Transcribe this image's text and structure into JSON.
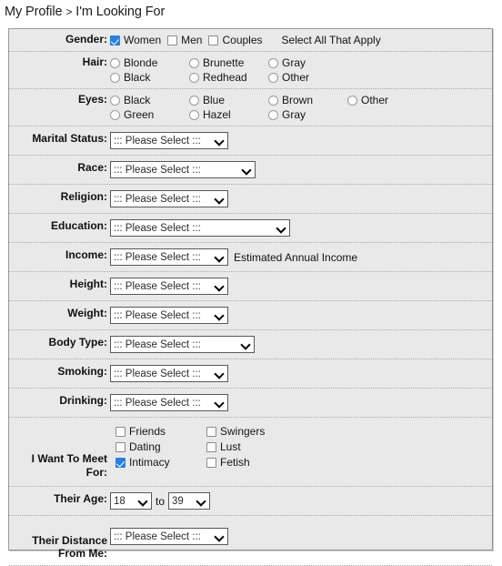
{
  "breadcrumb": {
    "parent": "My Profile",
    "separator": ">",
    "current": "I'm Looking For"
  },
  "colors": {
    "panel_bg": "#e9e9e9",
    "panel_border": "#9b9b9b",
    "checkbox_checked": "#2a7fde",
    "separator": "#a9a9a9",
    "text": "#151515"
  },
  "placeholder_select": "::: Please Select :::",
  "rows": {
    "gender": {
      "label": "Gender:",
      "hint": "Select All That Apply",
      "options": [
        {
          "label": "Women",
          "checked": true
        },
        {
          "label": "Men",
          "checked": false
        },
        {
          "label": "Couples",
          "checked": false
        }
      ]
    },
    "hair": {
      "label": "Hair:",
      "options": [
        {
          "label": "Blonde",
          "checked": false
        },
        {
          "label": "Brunette",
          "checked": false
        },
        {
          "label": "Gray",
          "checked": false
        },
        {
          "label": "Black",
          "checked": false
        },
        {
          "label": "Redhead",
          "checked": false
        },
        {
          "label": "Other",
          "checked": false
        }
      ]
    },
    "eyes": {
      "label": "Eyes:",
      "options": [
        {
          "label": "Black",
          "checked": false
        },
        {
          "label": "Blue",
          "checked": false
        },
        {
          "label": "Brown",
          "checked": false
        },
        {
          "label": "Other",
          "checked": false
        },
        {
          "label": "Green",
          "checked": false
        },
        {
          "label": "Hazel",
          "checked": false
        },
        {
          "label": "Gray",
          "checked": false
        }
      ]
    },
    "marital_status": {
      "label": "Marital Status:",
      "value": "::: Please Select :::"
    },
    "race": {
      "label": "Race:",
      "value": "::: Please Select :::"
    },
    "religion": {
      "label": "Religion:",
      "value": "::: Please Select :::"
    },
    "education": {
      "label": "Education:",
      "value": "::: Please Select :::"
    },
    "income": {
      "label": "Income:",
      "value": "::: Please Select :::",
      "hint": "Estimated Annual Income"
    },
    "height": {
      "label": "Height:",
      "value": "::: Please Select :::"
    },
    "weight": {
      "label": "Weight:",
      "value": "::: Please Select :::"
    },
    "body_type": {
      "label": "Body Type:",
      "value": "::: Please Select :::"
    },
    "smoking": {
      "label": "Smoking:",
      "value": "::: Please Select :::"
    },
    "drinking": {
      "label": "Drinking:",
      "value": "::: Please Select :::"
    },
    "meet_for": {
      "label": "I Want To Meet For:",
      "options": [
        {
          "label": "Friends",
          "checked": false
        },
        {
          "label": "Swingers",
          "checked": false
        },
        {
          "label": "Dating",
          "checked": false
        },
        {
          "label": "Lust",
          "checked": false
        },
        {
          "label": "Intimacy",
          "checked": true
        },
        {
          "label": "Fetish",
          "checked": false
        }
      ]
    },
    "their_age": {
      "label": "Their Age:",
      "from_value": "18",
      "separator": "to",
      "to_value": "39"
    },
    "their_distance": {
      "label": "Their Distance From Me:",
      "value": "::: Please Select :::"
    }
  }
}
